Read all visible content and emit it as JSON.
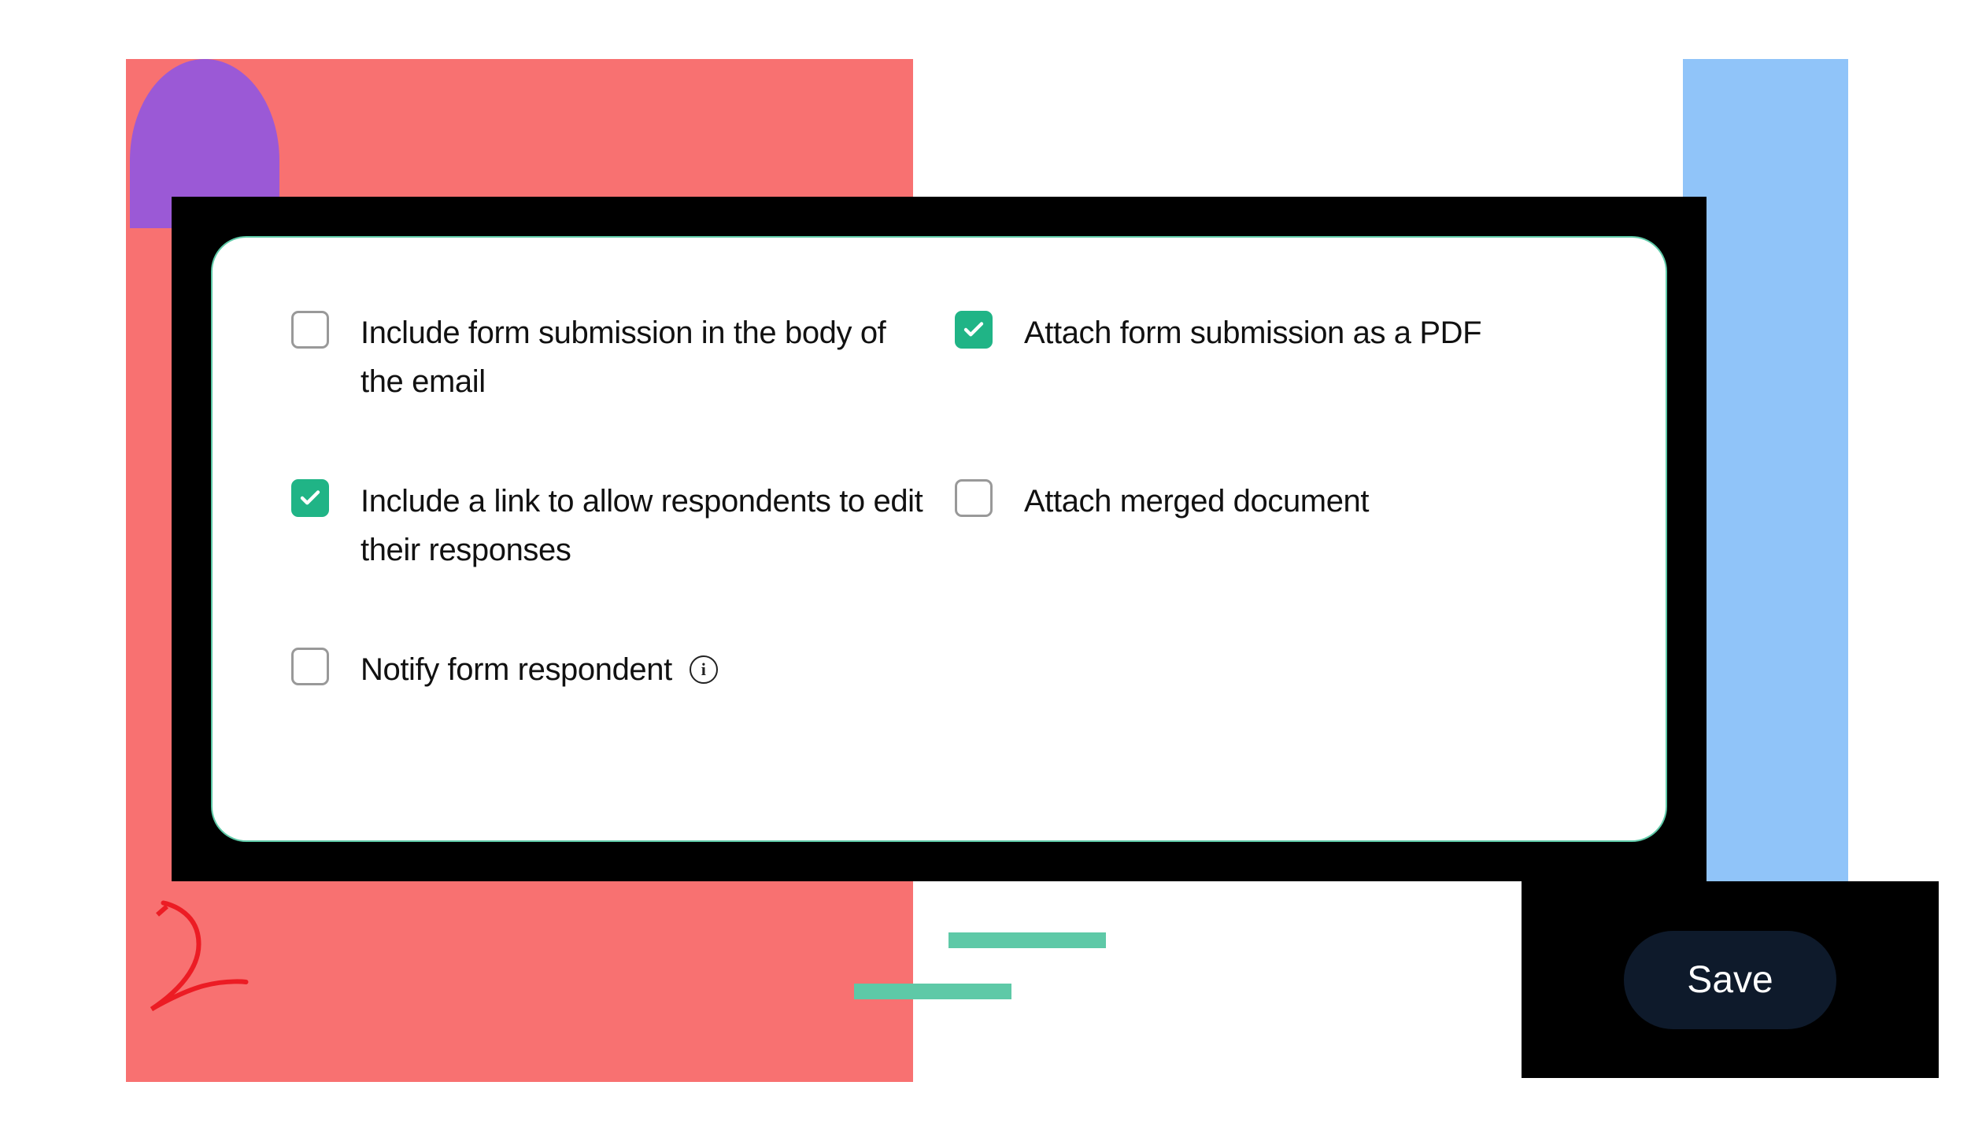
{
  "options": {
    "include_body": {
      "label": "Include form submission in the body of the email",
      "checked": false
    },
    "attach_pdf": {
      "label": "Attach form submission as a PDF",
      "checked": true
    },
    "include_edit_link": {
      "label": "Include a link to allow respondents to edit their responses",
      "checked": true
    },
    "attach_merged": {
      "label": "Attach merged document",
      "checked": false
    },
    "notify_respondent": {
      "label": "Notify form respondent",
      "checked": false
    }
  },
  "buttons": {
    "save": "Save"
  },
  "colors": {
    "accent_teal": "#20b486",
    "panel_border": "#5ec9a7",
    "coral": "#f87171",
    "purple": "#9b59d6",
    "blue": "#90c4f9",
    "save_bg": "#0e1a2b"
  }
}
